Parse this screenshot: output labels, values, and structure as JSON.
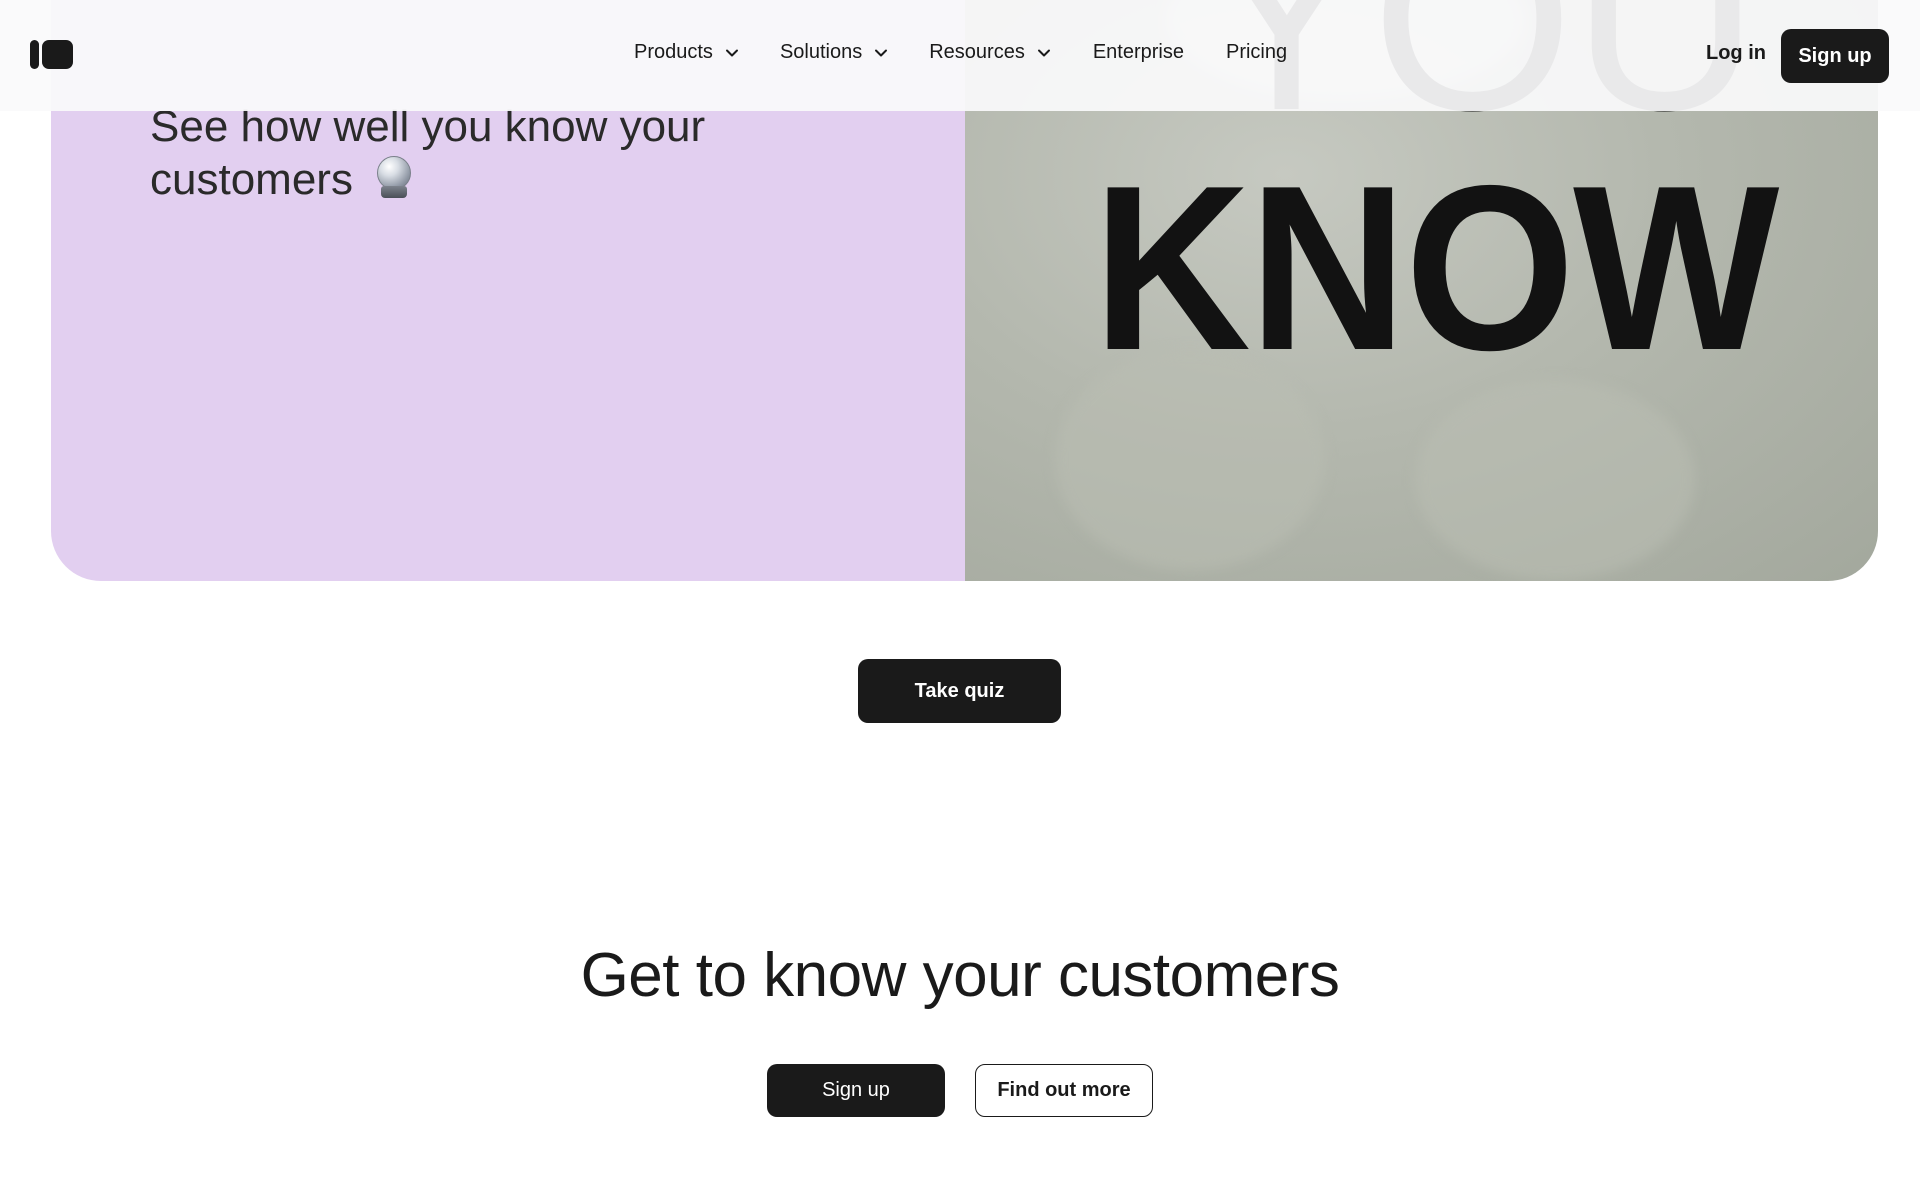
{
  "nav": {
    "items": [
      {
        "label": "Products",
        "has_dropdown": true
      },
      {
        "label": "Solutions",
        "has_dropdown": true
      },
      {
        "label": "Resources",
        "has_dropdown": true
      },
      {
        "label": "Enterprise",
        "has_dropdown": false
      },
      {
        "label": "Pricing",
        "has_dropdown": false
      }
    ],
    "login_label": "Log in",
    "signup_label": "Sign up",
    "logo_icon": "intercom-logo-icon",
    "dropdown_icon": "chevron-down-icon"
  },
  "hero": {
    "text": "See how well you know your customers",
    "emoji_icon": "crystal-ball-icon",
    "video_words": {
      "top": "YOU",
      "bottom": "KNOW"
    },
    "left_bg_color": "#e2cff0"
  },
  "quiz_button_label": "Take quiz",
  "cta": {
    "headline": "Get to know your customers",
    "signup_label": "Sign up",
    "find_out_more_label": "Find out more"
  },
  "colors": {
    "dark_button": "#1a1a1a",
    "text": "#191919"
  }
}
